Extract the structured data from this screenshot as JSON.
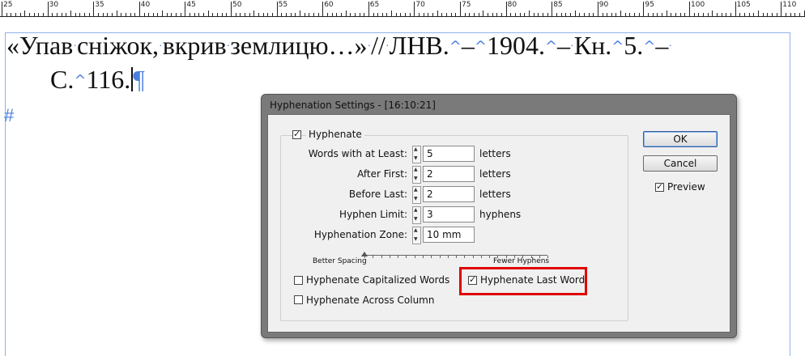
{
  "ruler": {
    "labels": [
      "25",
      "30",
      "35",
      "40",
      "45",
      "50",
      "55",
      "60",
      "65",
      "70",
      "75",
      "80",
      "85",
      "90",
      "95",
      "100",
      "105",
      "110"
    ]
  },
  "document": {
    "line1": {
      "part1": "«Упав",
      "part2": "сніжок,",
      "part3": "вкрив",
      "part4": "землицю…»",
      "part5": "//",
      "part6": "ЛНВ.",
      "part7": "–",
      "part8": "1904.",
      "part9": "–",
      "part10": "Кн.",
      "part11": "5.",
      "part12": "–"
    },
    "line2": {
      "part1": "С.",
      "part2": "116."
    },
    "hash": "#"
  },
  "dialog": {
    "title": "Hyphenation Settings - [16:10:21]",
    "hyphenate_label": "Hyphenate",
    "fields": [
      {
        "label": "Words with at Least:",
        "value": "5",
        "unit": "letters"
      },
      {
        "label": "After First:",
        "value": "2",
        "unit": "letters"
      },
      {
        "label": "Before Last:",
        "value": "2",
        "unit": "letters"
      },
      {
        "label": "Hyphen Limit:",
        "value": "3",
        "unit": "hyphens"
      },
      {
        "label": "Hyphenation Zone:",
        "value": "10 mm",
        "unit": ""
      }
    ],
    "slider": {
      "left_label": "Better Spacing",
      "right_label": "Fewer Hyphens",
      "value": 0
    },
    "checkboxes": {
      "capitalized": "Hyphenate Capitalized Words",
      "last_word": "Hyphenate Last Word",
      "across_column": "Hyphenate Across Column",
      "preview": "Preview"
    },
    "buttons": {
      "ok": "OK",
      "cancel": "Cancel"
    },
    "highlight_color": "#e00000"
  }
}
